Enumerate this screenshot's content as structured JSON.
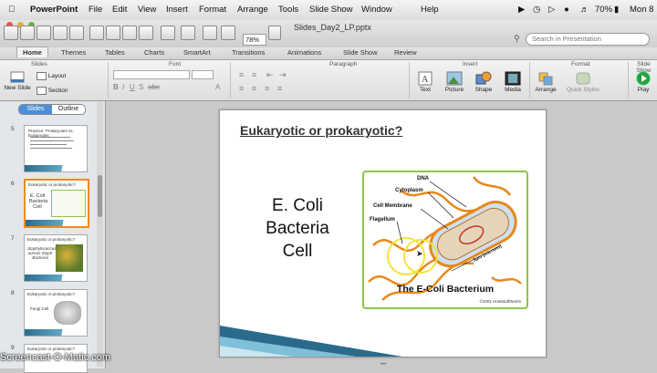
{
  "menubar": {
    "app": "PowerPoint",
    "items": [
      "File",
      "Edit",
      "View",
      "Insert",
      "Format",
      "Arrange",
      "Tools",
      "Slide Show",
      "Window",
      "Help"
    ],
    "battery": "70%",
    "clock": "Mon 8"
  },
  "window": {
    "title": "Slides_Day2_LP.pptx",
    "zoom": "78%",
    "search_placeholder": "Search in Presentation"
  },
  "ribbon": {
    "tabs": [
      "Home",
      "Themes",
      "Tables",
      "Charts",
      "SmartArt",
      "Transitions",
      "Animations",
      "Slide Show",
      "Review"
    ],
    "groups": {
      "slides": "Slides",
      "font": "Font",
      "paragraph": "Paragraph",
      "insert": "Insert",
      "format": "Format",
      "slide_show": "Slide Show"
    },
    "buttons": {
      "new_slide": "New Slide",
      "layout": "Layout",
      "section": "Section",
      "text": "Text",
      "picture": "Picture",
      "shape": "Shape",
      "media": "Media",
      "arrange": "Arrange",
      "quick_styles": "Quick Styles",
      "play": "Play"
    }
  },
  "left_pane": {
    "tabs": [
      "Slides",
      "Outline"
    ],
    "thumbnails": [
      {
        "num": "5",
        "title": "Practice: Prokaryotes vs. Eukaryotes"
      },
      {
        "num": "6",
        "title": "Eukaryotic or prokaryotic?",
        "body": "E. Coli Bacteria Cell"
      },
      {
        "num": "7",
        "title": "Eukaryotic or prokaryotic?",
        "body": "Staphylococcus aureus Staph Bacterial"
      },
      {
        "num": "8",
        "title": "Eukaryotic or prokaryotic?",
        "body": "Fungi Cell"
      },
      {
        "num": "9",
        "title": "Eukaryotic or prokaryotic?"
      }
    ]
  },
  "slide": {
    "title": "Eukaryotic or prokaryotic?",
    "body_lines": [
      "E. Coli",
      "Bacteria",
      "Cell"
    ],
    "figure": {
      "labels": [
        "DNA",
        "Cytoplasm",
        "Cell Membrane",
        "Flagellum",
        "3μm (microns)"
      ],
      "caption": "The E-Coli Bacterium",
      "credit": "©2001 HowStuffWorks"
    },
    "colors": {
      "band_dark": "#2a6b8c",
      "band_light": "#7fbfd8",
      "figure_border": "#8fc24a",
      "flagella": "#e8891a"
    }
  },
  "watermark": "Screencast-O-Matic.com"
}
